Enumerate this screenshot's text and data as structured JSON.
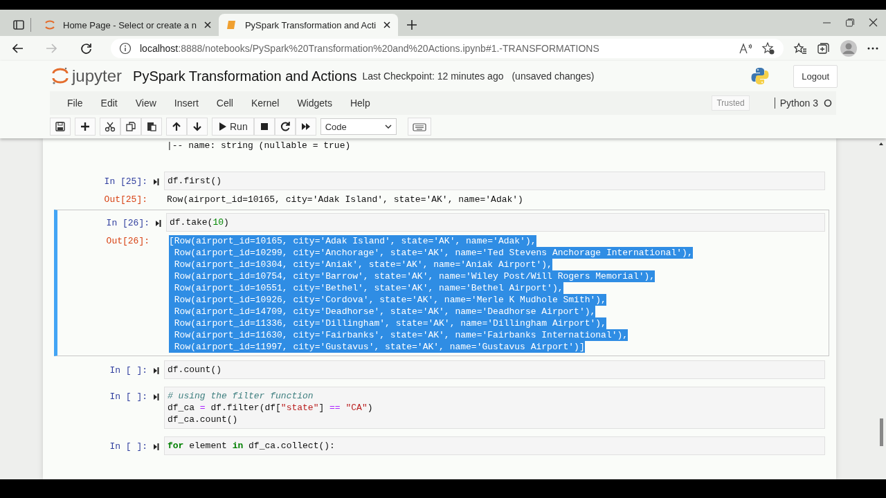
{
  "browser": {
    "tabs": [
      {
        "title": "Home Page - Select or create a n",
        "kind": "jupyter",
        "selected": false
      },
      {
        "title": "PySpark Transformation and Acti",
        "kind": "notebook",
        "selected": true
      }
    ],
    "address": "localhost:8888/notebooks/PySpark%20Transformation%20and%20Actions.ipynb#1.-TRANSFORMATIONS"
  },
  "header": {
    "logo_text": "jupyter",
    "notebook_title": "PySpark Transformation and Actions",
    "checkpoint": "Last Checkpoint: 12 minutes ago",
    "autosave": "(unsaved changes)",
    "logout": "Logout"
  },
  "menu": {
    "items": [
      "File",
      "Edit",
      "View",
      "Insert",
      "Cell",
      "Kernel",
      "Widgets",
      "Help"
    ],
    "trusted": "Trusted",
    "kernel": "Python 3"
  },
  "toolbar": {
    "run": "Run",
    "cell_type": "Code"
  },
  "cells": [
    {
      "kind": "output-only",
      "output": [
        "|-- name: string (nullable = true)"
      ]
    },
    {
      "kind": "code",
      "selected": false,
      "prompt": "In [25]:",
      "code": [
        [
          {
            "t": "df.first()",
            "kind": "plain"
          }
        ]
      ],
      "out_prompt": "Out[25]:",
      "output_highlighted": false,
      "output": [
        "Row(airport_id=10165, city='Adak Island', state='AK', name='Adak')"
      ]
    },
    {
      "kind": "code",
      "selected": true,
      "prompt": "In [26]:",
      "code": [
        [
          {
            "t": "df.take(",
            "kind": "plain"
          },
          {
            "t": "10",
            "kind": "number"
          },
          {
            "t": ")",
            "kind": "plain"
          }
        ]
      ],
      "out_prompt": "Out[26]:",
      "output_highlighted": true,
      "output": [
        "[Row(airport_id=10165, city='Adak Island', state='AK', name='Adak'),",
        " Row(airport_id=10299, city='Anchorage', state='AK', name='Ted Stevens Anchorage International'),",
        " Row(airport_id=10304, city='Aniak', state='AK', name='Aniak Airport'),",
        " Row(airport_id=10754, city='Barrow', state='AK', name='Wiley Post/Will Rogers Memorial'),",
        " Row(airport_id=10551, city='Bethel', state='AK', name='Bethel Airport'),",
        " Row(airport_id=10926, city='Cordova', state='AK', name='Merle K Mudhole Smith'),",
        " Row(airport_id=14709, city='Deadhorse', state='AK', name='Deadhorse Airport'),",
        " Row(airport_id=11336, city='Dillingham', state='AK', name='Dillingham Airport'),",
        " Row(airport_id=11630, city='Fairbanks', state='AK', name='Fairbanks International'),",
        " Row(airport_id=11997, city='Gustavus', state='AK', name='Gustavus Airport')]"
      ]
    },
    {
      "kind": "code",
      "selected": false,
      "prompt": "In [ ]:",
      "code": [
        [
          {
            "t": "df.count()",
            "kind": "plain"
          }
        ]
      ]
    },
    {
      "kind": "code",
      "selected": false,
      "prompt": "In [ ]:",
      "code": [
        [
          {
            "t": "# using the filter function",
            "kind": "comment"
          }
        ],
        [
          {
            "t": "df_ca ",
            "kind": "plain"
          },
          {
            "t": "=",
            "kind": "operator"
          },
          {
            "t": " df.filter(df[",
            "kind": "plain"
          },
          {
            "t": "\"state\"",
            "kind": "string"
          },
          {
            "t": "] ",
            "kind": "plain"
          },
          {
            "t": "==",
            "kind": "operator"
          },
          {
            "t": " \"CA\"",
            "kind": "string"
          },
          {
            "t": ")",
            "kind": "plain"
          }
        ],
        [
          {
            "t": "df_ca.count()",
            "kind": "plain"
          }
        ]
      ]
    },
    {
      "kind": "code",
      "selected": false,
      "prompt": "In [ ]:",
      "code": [
        [
          {
            "t": "for",
            "kind": "keyword"
          },
          {
            "t": " element ",
            "kind": "plain"
          },
          {
            "t": "in",
            "kind": "keyword"
          },
          {
            "t": " df_ca.collect():",
            "kind": "plain"
          }
        ]
      ]
    }
  ]
}
